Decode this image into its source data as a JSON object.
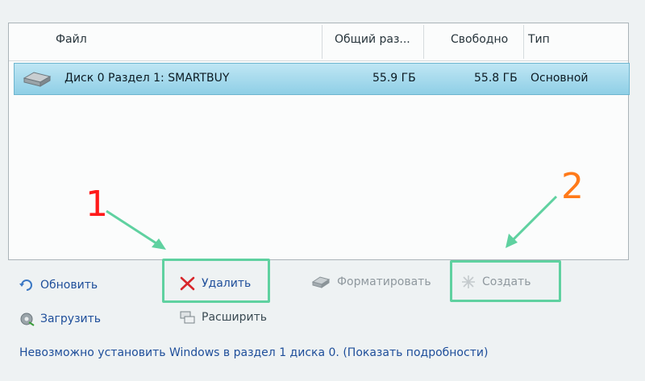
{
  "table": {
    "columns": [
      "Файл",
      "Общий раз...",
      "Свободно",
      "Тип"
    ],
    "rows": [
      {
        "name": "Диск 0 Раздел 1: SMARTBUY",
        "total": "55.9 ГБ",
        "free": "55.8 ГБ",
        "type": "Основной"
      }
    ]
  },
  "toolbar": {
    "refresh": "Обновить",
    "delete": "Удалить",
    "format": "Форматировать",
    "create": "Создать",
    "load": "Загрузить",
    "extend": "Расширить"
  },
  "annotations": {
    "label1": "1",
    "label2": "2",
    "label1_color": "#ff1a1a",
    "label2_color": "#ff7a1a",
    "highlight_color": "#5fd1a0"
  },
  "status": {
    "message": "Невозможно установить Windows в раздел 1 диска 0. (Показать подробности)"
  }
}
